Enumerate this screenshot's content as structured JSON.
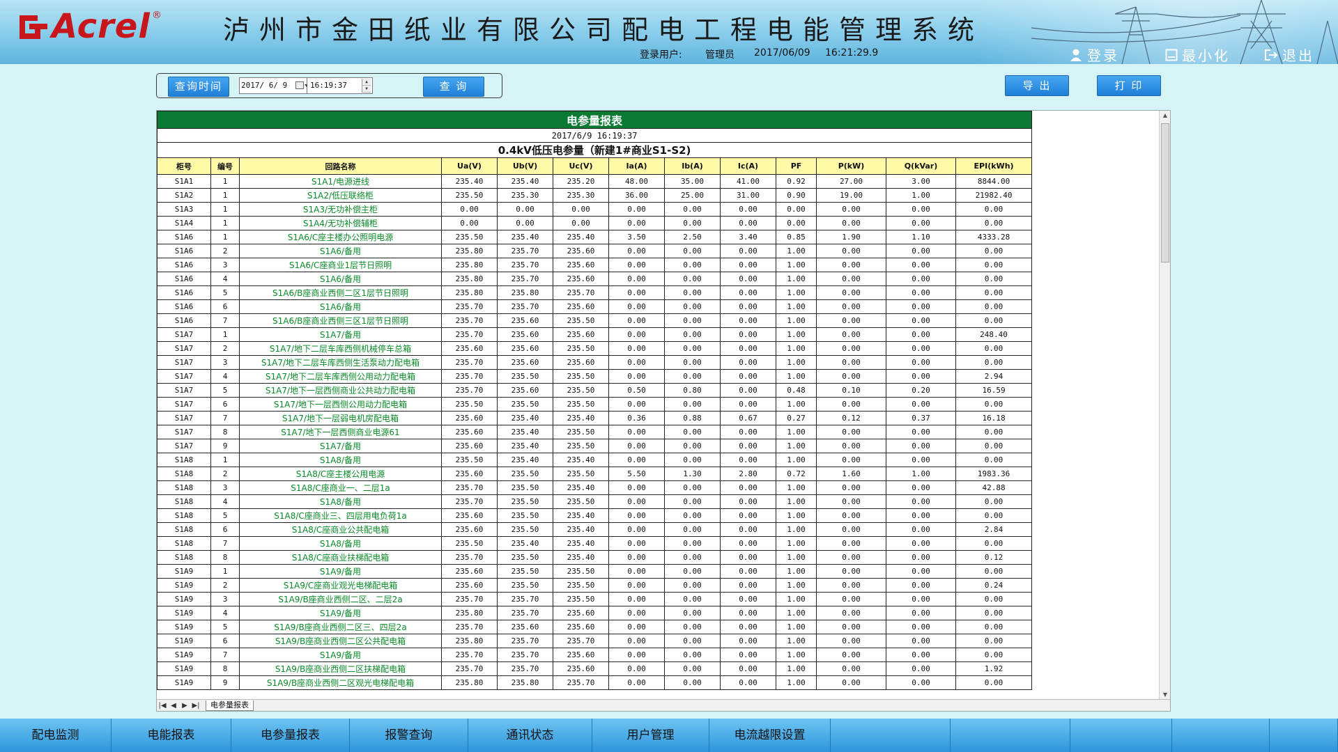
{
  "header": {
    "brand": "Acrel",
    "brand_reg": "®",
    "system_title": "泸州市金田纸业有限公司配电工程电能管理系统",
    "login_user_label": "登录用户:",
    "user_name": "管理员",
    "date": "2017/06/09",
    "time": "16:21:29.9",
    "login_label": "登录",
    "minimize_label": "最小化",
    "exit_label": "退出"
  },
  "query": {
    "button_label": "查询时间",
    "date_value": "2017/ 6/ 9",
    "time_value": "16:19:37",
    "search_label": "查 询"
  },
  "actions": {
    "export_label": "导 出",
    "print_label": "打 印"
  },
  "report": {
    "title": "电参量报表",
    "datetime": "2017/6/9 16:19:37",
    "subtitle": "0.4kV低压电参量（新建1#商业S1-S2)",
    "columns": [
      "柜号",
      "编号",
      "回路名称",
      "Ua(V)",
      "Ub(V)",
      "Uc(V)",
      "Ia(A)",
      "Ib(A)",
      "Ic(A)",
      "PF",
      "P(kW)",
      "Q(kVar)",
      "EPI(kWh)"
    ],
    "rows": [
      [
        "S1A1",
        "1",
        "S1A1/电源进线",
        "235.40",
        "235.40",
        "235.20",
        "48.00",
        "35.00",
        "41.00",
        "0.92",
        "27.00",
        "3.00",
        "8844.00"
      ],
      [
        "S1A2",
        "1",
        "S1A2/低压联络柜",
        "235.50",
        "235.30",
        "235.30",
        "36.00",
        "25.00",
        "31.00",
        "0.90",
        "19.00",
        "1.00",
        "21982.40"
      ],
      [
        "S1A3",
        "1",
        "S1A3/无功补偿主柜",
        "0.00",
        "0.00",
        "0.00",
        "0.00",
        "0.00",
        "0.00",
        "0.00",
        "0.00",
        "0.00",
        "0.00"
      ],
      [
        "S1A4",
        "1",
        "S1A4/无功补偿辅柜",
        "0.00",
        "0.00",
        "0.00",
        "0.00",
        "0.00",
        "0.00",
        "0.00",
        "0.00",
        "0.00",
        "0.00"
      ],
      [
        "S1A6",
        "1",
        "S1A6/C座主楼办公照明电源",
        "235.50",
        "235.40",
        "235.40",
        "3.50",
        "2.50",
        "3.40",
        "0.85",
        "1.90",
        "1.10",
        "4333.28"
      ],
      [
        "S1A6",
        "2",
        "S1A6/备用",
        "235.80",
        "235.70",
        "235.60",
        "0.00",
        "0.00",
        "0.00",
        "1.00",
        "0.00",
        "0.00",
        "0.00"
      ],
      [
        "S1A6",
        "3",
        "S1A6/C座商业1层节日照明",
        "235.80",
        "235.70",
        "235.60",
        "0.00",
        "0.00",
        "0.00",
        "1.00",
        "0.00",
        "0.00",
        "0.00"
      ],
      [
        "S1A6",
        "4",
        "S1A6/备用",
        "235.80",
        "235.70",
        "235.60",
        "0.00",
        "0.00",
        "0.00",
        "1.00",
        "0.00",
        "0.00",
        "0.00"
      ],
      [
        "S1A6",
        "5",
        "S1A6/B座商业西侧二区1层节日照明",
        "235.80",
        "235.80",
        "235.70",
        "0.00",
        "0.00",
        "0.00",
        "1.00",
        "0.00",
        "0.00",
        "0.00"
      ],
      [
        "S1A6",
        "6",
        "S1A6/备用",
        "235.70",
        "235.70",
        "235.60",
        "0.00",
        "0.00",
        "0.00",
        "1.00",
        "0.00",
        "0.00",
        "0.00"
      ],
      [
        "S1A6",
        "7",
        "S1A6/B座商业西侧三区1层节日照明",
        "235.70",
        "235.60",
        "235.50",
        "0.00",
        "0.00",
        "0.00",
        "1.00",
        "0.00",
        "0.00",
        "0.00"
      ],
      [
        "S1A7",
        "1",
        "S1A7/备用",
        "235.70",
        "235.60",
        "235.60",
        "0.00",
        "0.00",
        "0.00",
        "1.00",
        "0.00",
        "0.00",
        "248.40"
      ],
      [
        "S1A7",
        "2",
        "S1A7/地下二层车库西侧机械停车总箱",
        "235.60",
        "235.60",
        "235.50",
        "0.00",
        "0.00",
        "0.00",
        "1.00",
        "0.00",
        "0.00",
        "0.00"
      ],
      [
        "S1A7",
        "3",
        "S1A7/地下二层车库西侧生活泵动力配电箱",
        "235.70",
        "235.60",
        "235.60",
        "0.00",
        "0.00",
        "0.00",
        "1.00",
        "0.00",
        "0.00",
        "0.00"
      ],
      [
        "S1A7",
        "4",
        "S1A7/地下二层车库西侧公用动力配电箱",
        "235.70",
        "235.50",
        "235.50",
        "0.00",
        "0.00",
        "0.00",
        "1.00",
        "0.00",
        "0.00",
        "2.94"
      ],
      [
        "S1A7",
        "5",
        "S1A7/地下一层西侧商业公共动力配电箱",
        "235.70",
        "235.60",
        "235.50",
        "0.50",
        "0.80",
        "0.00",
        "0.48",
        "0.10",
        "0.20",
        "16.59"
      ],
      [
        "S1A7",
        "6",
        "S1A7/地下一层西侧公用动力配电箱",
        "235.50",
        "235.50",
        "235.50",
        "0.00",
        "0.00",
        "0.00",
        "1.00",
        "0.00",
        "0.00",
        "0.00"
      ],
      [
        "S1A7",
        "7",
        "S1A7/地下一层弱电机房配电箱",
        "235.60",
        "235.40",
        "235.40",
        "0.36",
        "0.88",
        "0.67",
        "0.27",
        "0.12",
        "0.37",
        "16.18"
      ],
      [
        "S1A7",
        "8",
        "S1A7/地下一层西侧商业电源61",
        "235.60",
        "235.40",
        "235.50",
        "0.00",
        "0.00",
        "0.00",
        "1.00",
        "0.00",
        "0.00",
        "0.00"
      ],
      [
        "S1A7",
        "9",
        "S1A7/备用",
        "235.60",
        "235.40",
        "235.50",
        "0.00",
        "0.00",
        "0.00",
        "1.00",
        "0.00",
        "0.00",
        "0.00"
      ],
      [
        "S1A8",
        "1",
        "S1A8/备用",
        "235.50",
        "235.40",
        "235.40",
        "0.00",
        "0.00",
        "0.00",
        "1.00",
        "0.00",
        "0.00",
        "0.00"
      ],
      [
        "S1A8",
        "2",
        "S1A8/C座主楼公用电源",
        "235.60",
        "235.50",
        "235.50",
        "5.50",
        "1.30",
        "2.80",
        "0.72",
        "1.60",
        "1.00",
        "1983.36"
      ],
      [
        "S1A8",
        "3",
        "S1A8/C座商业一、二层1a",
        "235.70",
        "235.50",
        "235.40",
        "0.00",
        "0.00",
        "0.00",
        "1.00",
        "0.00",
        "0.00",
        "42.88"
      ],
      [
        "S1A8",
        "4",
        "S1A8/备用",
        "235.70",
        "235.50",
        "235.50",
        "0.00",
        "0.00",
        "0.00",
        "1.00",
        "0.00",
        "0.00",
        "0.00"
      ],
      [
        "S1A8",
        "5",
        "S1A8/C座商业三、四层用电负荷1a",
        "235.60",
        "235.50",
        "235.40",
        "0.00",
        "0.00",
        "0.00",
        "1.00",
        "0.00",
        "0.00",
        "0.00"
      ],
      [
        "S1A8",
        "6",
        "S1A8/C座商业公共配电箱",
        "235.60",
        "235.50",
        "235.40",
        "0.00",
        "0.00",
        "0.00",
        "1.00",
        "0.00",
        "0.00",
        "2.84"
      ],
      [
        "S1A8",
        "7",
        "S1A8/备用",
        "235.50",
        "235.40",
        "235.40",
        "0.00",
        "0.00",
        "0.00",
        "1.00",
        "0.00",
        "0.00",
        "0.00"
      ],
      [
        "S1A8",
        "8",
        "S1A8/C座商业扶梯配电箱",
        "235.70",
        "235.50",
        "235.40",
        "0.00",
        "0.00",
        "0.00",
        "1.00",
        "0.00",
        "0.00",
        "0.12"
      ],
      [
        "S1A9",
        "1",
        "S1A9/备用",
        "235.60",
        "235.50",
        "235.50",
        "0.00",
        "0.00",
        "0.00",
        "1.00",
        "0.00",
        "0.00",
        "0.00"
      ],
      [
        "S1A9",
        "2",
        "S1A9/C座商业观光电梯配电箱",
        "235.60",
        "235.50",
        "235.50",
        "0.00",
        "0.00",
        "0.00",
        "1.00",
        "0.00",
        "0.00",
        "0.24"
      ],
      [
        "S1A9",
        "3",
        "S1A9/B座商业西侧二区、二层2a",
        "235.70",
        "235.70",
        "235.50",
        "0.00",
        "0.00",
        "0.00",
        "1.00",
        "0.00",
        "0.00",
        "0.00"
      ],
      [
        "S1A9",
        "4",
        "S1A9/备用",
        "235.80",
        "235.70",
        "235.60",
        "0.00",
        "0.00",
        "0.00",
        "1.00",
        "0.00",
        "0.00",
        "0.00"
      ],
      [
        "S1A9",
        "5",
        "S1A9/B座商业西侧二区三、四层2a",
        "235.70",
        "235.60",
        "235.60",
        "0.00",
        "0.00",
        "0.00",
        "1.00",
        "0.00",
        "0.00",
        "0.00"
      ],
      [
        "S1A9",
        "6",
        "S1A9/B座商业西侧二区公共配电箱",
        "235.80",
        "235.70",
        "235.70",
        "0.00",
        "0.00",
        "0.00",
        "1.00",
        "0.00",
        "0.00",
        "0.00"
      ],
      [
        "S1A9",
        "7",
        "S1A9/备用",
        "235.70",
        "235.70",
        "235.60",
        "0.00",
        "0.00",
        "0.00",
        "1.00",
        "0.00",
        "0.00",
        "0.00"
      ],
      [
        "S1A9",
        "8",
        "S1A9/B座商业西侧二区扶梯配电箱",
        "235.70",
        "235.70",
        "235.60",
        "0.00",
        "0.00",
        "0.00",
        "1.00",
        "0.00",
        "0.00",
        "1.92"
      ],
      [
        "S1A9",
        "9",
        "S1A9/B座商业西侧二区观光电梯配电箱",
        "235.80",
        "235.80",
        "235.70",
        "0.00",
        "0.00",
        "0.00",
        "1.00",
        "0.00",
        "0.00",
        "0.00"
      ]
    ],
    "sheet_tab": "电参量报表"
  },
  "nav": {
    "items": [
      "配电监测",
      "电能报表",
      "电参量报表",
      "报警查询",
      "通讯状态",
      "用户管理",
      "电流越限设置",
      "",
      "",
      "",
      "",
      ""
    ]
  },
  "colors": {
    "title_bar": "#0a7a32",
    "header_row": "#fff9a8",
    "circuit_text": "#0a8a28",
    "button_blue": "#1f7fd8"
  }
}
